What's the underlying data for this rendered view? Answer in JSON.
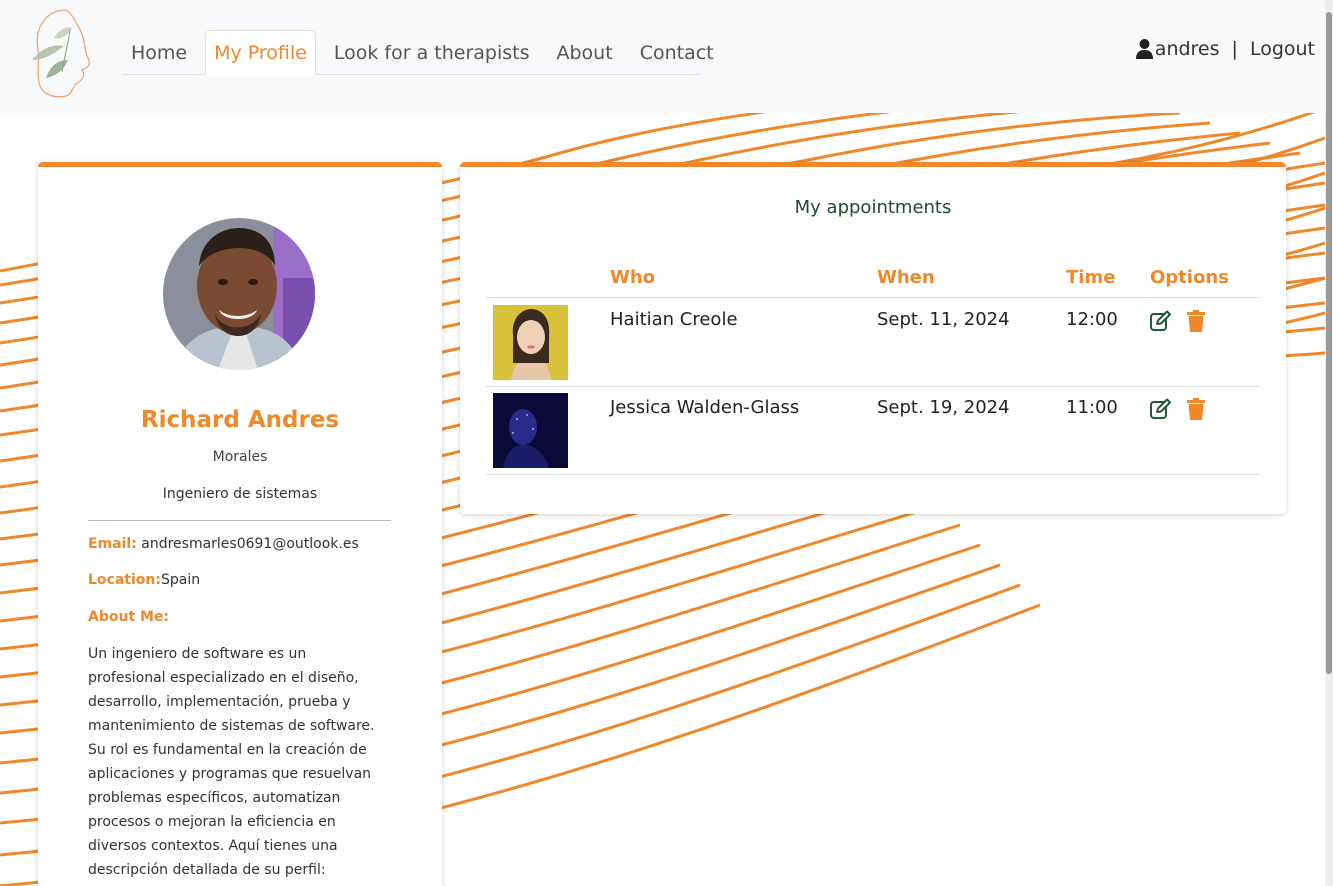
{
  "nav": {
    "items": [
      {
        "label": "Home"
      },
      {
        "label": "My Profile"
      },
      {
        "label": "Look for a therapists"
      },
      {
        "label": "About"
      },
      {
        "label": "Contact"
      }
    ],
    "active": "My Profile"
  },
  "user": {
    "username": "andres",
    "separator": "|",
    "logout_label": "Logout"
  },
  "profile": {
    "name": "Richard Andres",
    "lastname": "Morales",
    "title": "Ingeniero de sistemas",
    "email_label": "Email:",
    "email": "andresmarles0691@outlook.es",
    "location_label": "Location:",
    "location": "Spain",
    "about_label": "About Me:",
    "about": "Un ingeniero de software es un profesional especializado en el diseño, desarrollo, implementación, prueba y mantenimiento de sistemas de software. Su rol es fundamental en la creación de aplicaciones y programas que resuelvan problemas específicos, automatizan procesos o mejoran la eficiencia en diversos contextos. Aquí tienes una descripción detallada de su perfil:"
  },
  "appointments": {
    "title": "My appointments",
    "headers": {
      "who": "Who",
      "when": "When",
      "time": "Time",
      "options": "Options"
    },
    "rows": [
      {
        "who": "Haitian Creole",
        "when": "Sept. 11, 2024",
        "time": "12:00"
      },
      {
        "who": "Jessica Walden-Glass",
        "when": "Sept. 19, 2024",
        "time": "11:00"
      }
    ]
  },
  "colors": {
    "accent": "#f0882a",
    "title_green": "#1e4b2e",
    "edit_icon": "#1e5a36"
  },
  "icons": {
    "user": "user-icon",
    "edit": "edit-icon",
    "delete": "trash-icon",
    "logo": "leaf-face-logo"
  }
}
